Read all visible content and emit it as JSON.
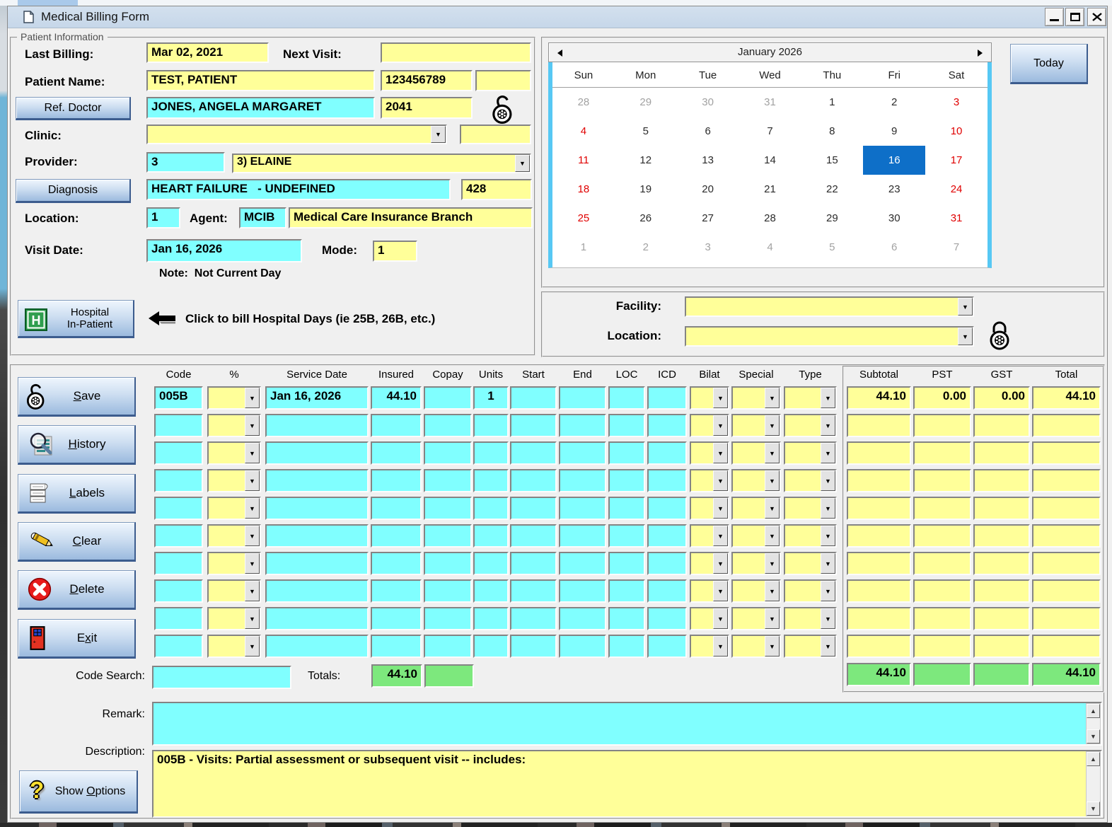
{
  "window": {
    "title": "Medical Billing Form"
  },
  "patient_info": {
    "legend": "Patient Information",
    "fields": {
      "last_billing": {
        "label": "Last Billing:",
        "value": "Mar 02, 2021"
      },
      "next_visit": {
        "label": "Next Visit:",
        "value": ""
      },
      "patient_name": {
        "label": "Patient Name:",
        "value": "TEST, PATIENT",
        "phn": "123456789",
        "extra": ""
      },
      "ref_doctor": {
        "button": "Ref. Doctor",
        "value": "JONES, ANGELA MARGARET",
        "code": "2041"
      },
      "clinic": {
        "label": "Clinic:",
        "value": "",
        "extra": ""
      },
      "provider": {
        "label": "Provider:",
        "code": "3",
        "value": "3) ELAINE"
      },
      "diagnosis": {
        "button": "Diagnosis",
        "value": "HEART FAILURE   - UNDEFINED",
        "code": "428"
      },
      "location": {
        "label": "Location:",
        "value": "1"
      },
      "agent": {
        "label": "Agent:",
        "code": "MCIB",
        "name": "Medical Care Insurance Branch"
      },
      "visit_date": {
        "label": "Visit Date:",
        "value": "Jan 16, 2026"
      },
      "mode": {
        "label": "Mode:",
        "value": "1"
      },
      "note": "Note:  Not Current Day"
    },
    "hospital": {
      "line1": "Hospital",
      "line2": "In-Patient",
      "hint": "Click to bill Hospital Days (ie 25B, 26B, etc.)"
    }
  },
  "calendar": {
    "title": "January 2026",
    "today_button": "Today",
    "day_headers": [
      "Sun",
      "Mon",
      "Tue",
      "Wed",
      "Thu",
      "Fri",
      "Sat"
    ],
    "weeks": [
      [
        {
          "d": "28",
          "s": "m"
        },
        {
          "d": "29",
          "s": "m"
        },
        {
          "d": "30",
          "s": "m"
        },
        {
          "d": "31",
          "s": "m"
        },
        {
          "d": "1",
          "s": ""
        },
        {
          "d": "2",
          "s": ""
        },
        {
          "d": "3",
          "s": "r"
        }
      ],
      [
        {
          "d": "4",
          "s": "r"
        },
        {
          "d": "5",
          "s": ""
        },
        {
          "d": "6",
          "s": ""
        },
        {
          "d": "7",
          "s": ""
        },
        {
          "d": "8",
          "s": ""
        },
        {
          "d": "9",
          "s": ""
        },
        {
          "d": "10",
          "s": "r"
        }
      ],
      [
        {
          "d": "11",
          "s": "r"
        },
        {
          "d": "12",
          "s": ""
        },
        {
          "d": "13",
          "s": ""
        },
        {
          "d": "14",
          "s": ""
        },
        {
          "d": "15",
          "s": ""
        },
        {
          "d": "16",
          "s": "x"
        },
        {
          "d": "17",
          "s": "r"
        }
      ],
      [
        {
          "d": "18",
          "s": "r"
        },
        {
          "d": "19",
          "s": ""
        },
        {
          "d": "20",
          "s": ""
        },
        {
          "d": "21",
          "s": ""
        },
        {
          "d": "22",
          "s": ""
        },
        {
          "d": "23",
          "s": ""
        },
        {
          "d": "24",
          "s": "r"
        }
      ],
      [
        {
          "d": "25",
          "s": "r"
        },
        {
          "d": "26",
          "s": ""
        },
        {
          "d": "27",
          "s": ""
        },
        {
          "d": "28",
          "s": ""
        },
        {
          "d": "29",
          "s": ""
        },
        {
          "d": "30",
          "s": ""
        },
        {
          "d": "31",
          "s": "r"
        }
      ],
      [
        {
          "d": "1",
          "s": "m"
        },
        {
          "d": "2",
          "s": "m"
        },
        {
          "d": "3",
          "s": "m"
        },
        {
          "d": "4",
          "s": "m"
        },
        {
          "d": "5",
          "s": "m"
        },
        {
          "d": "6",
          "s": "m"
        },
        {
          "d": "7",
          "s": "m"
        }
      ]
    ],
    "selected_day": "16"
  },
  "facility_panel": {
    "facility_label": "Facility:",
    "facility_value": "",
    "location_label": "Location:",
    "location_value": ""
  },
  "billing": {
    "columns": [
      "Code",
      "%",
      "Service Date",
      "Insured",
      "Copay",
      "Units",
      "Start",
      "End",
      "LOC",
      "ICD",
      "Bilat",
      "Special",
      "Type"
    ],
    "totals_columns": [
      "Subtotal",
      "PST",
      "GST",
      "Total"
    ],
    "rows": [
      {
        "code": "005B",
        "pct": "",
        "service_date": "Jan 16, 2026",
        "insured": "44.10",
        "copay": "",
        "units": "1",
        "start": "",
        "end": "",
        "loc": "",
        "icd": "",
        "bilat": "",
        "special": "",
        "type": "",
        "subtotal": "44.10",
        "pst": "0.00",
        "gst": "0.00",
        "total": "44.10"
      },
      {
        "code": "",
        "pct": "",
        "service_date": "",
        "insured": "",
        "copay": "",
        "units": "",
        "start": "",
        "end": "",
        "loc": "",
        "icd": "",
        "bilat": "",
        "special": "",
        "type": "",
        "subtotal": "",
        "pst": "",
        "gst": "",
        "total": ""
      },
      {
        "code": "",
        "pct": "",
        "service_date": "",
        "insured": "",
        "copay": "",
        "units": "",
        "start": "",
        "end": "",
        "loc": "",
        "icd": "",
        "bilat": "",
        "special": "",
        "type": "",
        "subtotal": "",
        "pst": "",
        "gst": "",
        "total": ""
      },
      {
        "code": "",
        "pct": "",
        "service_date": "",
        "insured": "",
        "copay": "",
        "units": "",
        "start": "",
        "end": "",
        "loc": "",
        "icd": "",
        "bilat": "",
        "special": "",
        "type": "",
        "subtotal": "",
        "pst": "",
        "gst": "",
        "total": ""
      },
      {
        "code": "",
        "pct": "",
        "service_date": "",
        "insured": "",
        "copay": "",
        "units": "",
        "start": "",
        "end": "",
        "loc": "",
        "icd": "",
        "bilat": "",
        "special": "",
        "type": "",
        "subtotal": "",
        "pst": "",
        "gst": "",
        "total": ""
      },
      {
        "code": "",
        "pct": "",
        "service_date": "",
        "insured": "",
        "copay": "",
        "units": "",
        "start": "",
        "end": "",
        "loc": "",
        "icd": "",
        "bilat": "",
        "special": "",
        "type": "",
        "subtotal": "",
        "pst": "",
        "gst": "",
        "total": ""
      },
      {
        "code": "",
        "pct": "",
        "service_date": "",
        "insured": "",
        "copay": "",
        "units": "",
        "start": "",
        "end": "",
        "loc": "",
        "icd": "",
        "bilat": "",
        "special": "",
        "type": "",
        "subtotal": "",
        "pst": "",
        "gst": "",
        "total": ""
      },
      {
        "code": "",
        "pct": "",
        "service_date": "",
        "insured": "",
        "copay": "",
        "units": "",
        "start": "",
        "end": "",
        "loc": "",
        "icd": "",
        "bilat": "",
        "special": "",
        "type": "",
        "subtotal": "",
        "pst": "",
        "gst": "",
        "total": ""
      },
      {
        "code": "",
        "pct": "",
        "service_date": "",
        "insured": "",
        "copay": "",
        "units": "",
        "start": "",
        "end": "",
        "loc": "",
        "icd": "",
        "bilat": "",
        "special": "",
        "type": "",
        "subtotal": "",
        "pst": "",
        "gst": "",
        "total": ""
      },
      {
        "code": "",
        "pct": "",
        "service_date": "",
        "insured": "",
        "copay": "",
        "units": "",
        "start": "",
        "end": "",
        "loc": "",
        "icd": "",
        "bilat": "",
        "special": "",
        "type": "",
        "subtotal": "",
        "pst": "",
        "gst": "",
        "total": ""
      }
    ],
    "code_search_label": "Code Search:",
    "code_search_value": "",
    "totals_label": "Totals:",
    "totals_left": [
      "44.10",
      ""
    ],
    "totals_right": [
      "44.10",
      "",
      "",
      "44.10"
    ]
  },
  "actions": [
    {
      "label": "Save",
      "u": 0,
      "icon": "padlock-open"
    },
    {
      "label": "History",
      "u": 0,
      "icon": "history"
    },
    {
      "label": "Labels",
      "u": 0,
      "icon": "labels"
    },
    {
      "label": "Clear",
      "u": 0,
      "icon": "clear"
    },
    {
      "label": "Delete",
      "u": 0,
      "icon": "delete"
    },
    {
      "label": "Exit",
      "u": 1,
      "icon": "exit"
    }
  ],
  "footer": {
    "remark_label": "Remark:",
    "remark_value": "",
    "description_label": "Description:",
    "description_value": "005B - Visits: Partial assessment or subsequent visit -- includes:",
    "show_options": {
      "label": "Show Options",
      "u": 5
    }
  },
  "colors": {
    "field_yellow": "#ffff99",
    "field_cyan": "#80ffff",
    "total_green": "#7de87d",
    "selected_blue": "#0e6fc8",
    "weekend_red": "#e00000"
  }
}
